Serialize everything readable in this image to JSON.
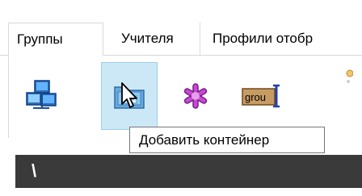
{
  "tabs": [
    {
      "label": "Группы"
    },
    {
      "label": "Учителя"
    },
    {
      "label": "Профили отобр"
    }
  ],
  "toolbar": {
    "group_label": "grou"
  },
  "tooltip": {
    "text": "Добавить контейнер"
  },
  "path": {
    "text": "\\"
  },
  "colors": {
    "hover_bg": "#cce8f7",
    "path_bg": "#3a3a3a"
  }
}
